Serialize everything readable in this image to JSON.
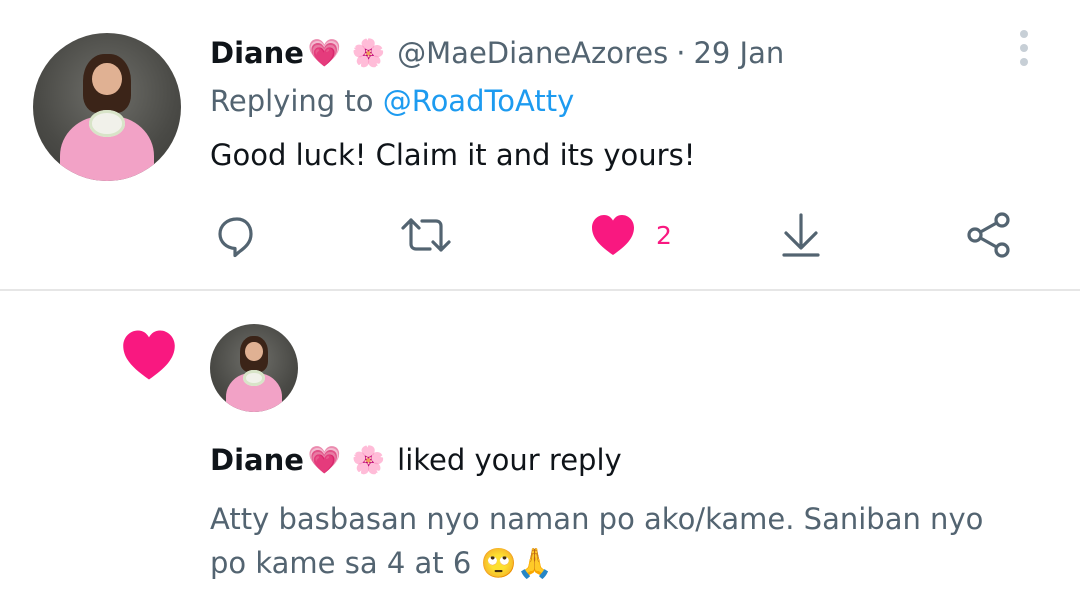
{
  "tweet": {
    "author_name": "Diane",
    "author_emoji_1": "💗",
    "author_emoji_2": "🌸",
    "handle": "@MaeDianeAzores",
    "separator": "·",
    "date": "29 Jan",
    "replying_prefix": "Replying to",
    "replying_mention": "@RoadToAtty",
    "text": "Good luck! Claim it and its yours!",
    "like_count": "2",
    "icons": [
      "reply-icon",
      "retweet-icon",
      "like-icon",
      "download-icon",
      "share-icon",
      "more-icon"
    ]
  },
  "notification": {
    "actor_name": "Diane",
    "actor_emoji_1": "💗",
    "actor_emoji_2": "🌸",
    "action_text": "liked your reply",
    "reply_text_line1": "Atty basbasan nyo naman po ako/kame. Saniban nyo",
    "reply_text_line2": "po kame sa 4 at 6 🙄🙏"
  },
  "colors": {
    "like_pink": "#f91880",
    "link_blue": "#1d9bf0",
    "secondary_gray": "#536471",
    "icon_gray": "#536471"
  }
}
